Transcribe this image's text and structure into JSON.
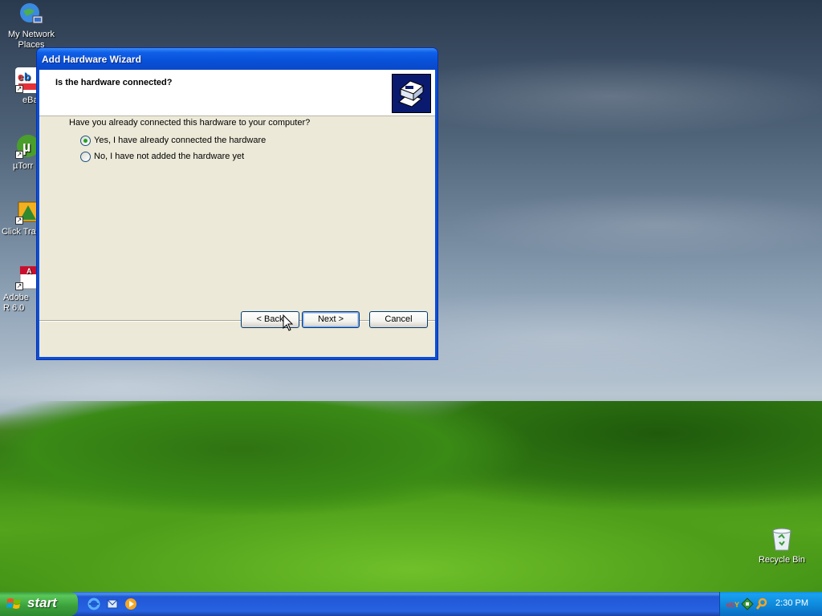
{
  "desktop": {
    "icons": [
      {
        "label": "My Network Places",
        "icon": "network-places-icon"
      },
      {
        "label": "eBa",
        "icon": "ebay-icon"
      },
      {
        "label": "µTorr",
        "icon": "utorrent-icon"
      },
      {
        "label": "Click Tra",
        "icon": "click-tracker-icon"
      },
      {
        "label": "Adobe R 6.0",
        "icon": "adobe-reader-icon"
      }
    ],
    "recycle_bin": {
      "label": "Recycle Bin",
      "icon": "recycle-bin-icon"
    }
  },
  "window": {
    "title": "Add Hardware Wizard",
    "header_title": "Is the hardware connected?",
    "header_icon": "hardware-wizard-icon",
    "question": "Have you already connected this hardware to your computer?",
    "options": [
      {
        "label": "Yes, I have already connected the hardware",
        "checked": true
      },
      {
        "label": "No, I have not added the hardware yet",
        "checked": false
      }
    ],
    "buttons": {
      "back": "< Back",
      "next": "Next >",
      "cancel": "Cancel"
    }
  },
  "taskbar": {
    "start_label": "start",
    "quick_launch": [
      "internet-explorer-icon",
      "outlook-express-icon",
      "media-player-icon"
    ],
    "tray_icons": [
      "ebay-tray-icon",
      "network-tray-icon",
      "search-tray-icon"
    ],
    "clock": "2:30 PM"
  }
}
